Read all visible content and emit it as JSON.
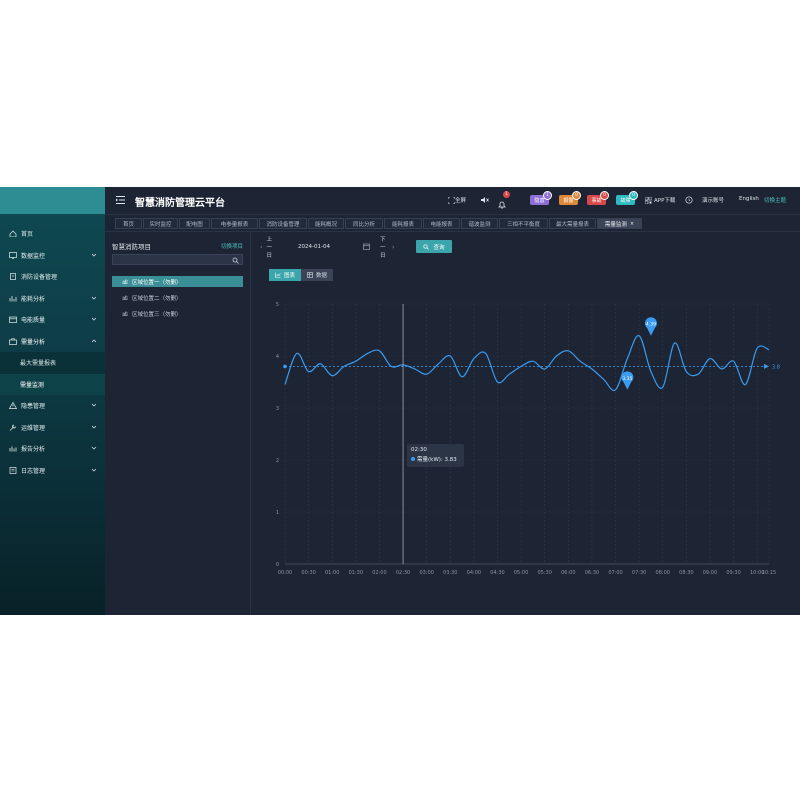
{
  "app": {
    "title": "智慧消防管理云平台"
  },
  "sidebar": {
    "items": [
      {
        "label": "首页",
        "icon": "home-icon",
        "has_arrow": false
      },
      {
        "label": "数据监控",
        "icon": "monitor-icon",
        "has_arrow": true
      },
      {
        "label": "消防设备管理",
        "icon": "device-icon",
        "has_arrow": false
      },
      {
        "label": "能耗分析",
        "icon": "bar-chart-icon",
        "has_arrow": true
      },
      {
        "label": "电能质量",
        "icon": "calendar-icon",
        "has_arrow": true
      },
      {
        "label": "需量分析",
        "icon": "briefcase-icon",
        "has_arrow": true,
        "open": true,
        "children": [
          {
            "label": "最大需量报表",
            "active": false
          },
          {
            "label": "需量监测",
            "active": true
          }
        ]
      },
      {
        "label": "隐患管理",
        "icon": "warning-icon",
        "has_arrow": true
      },
      {
        "label": "运维管理",
        "icon": "tools-icon",
        "has_arrow": true
      },
      {
        "label": "报告分析",
        "icon": "report-icon",
        "has_arrow": true
      },
      {
        "label": "日志管理",
        "icon": "log-icon",
        "has_arrow": true
      }
    ]
  },
  "header": {
    "fullscreen": "全屏",
    "bell_count": "1",
    "pills": [
      {
        "label": "隐患",
        "count": "1",
        "color": "#8e6fd6"
      },
      {
        "label": "报警",
        "count": "0",
        "color": "#e0883a"
      },
      {
        "label": "事故",
        "count": "0",
        "color": "#d84a4a"
      },
      {
        "label": "故障",
        "count": "0",
        "color": "#2fb9c0"
      }
    ],
    "app_download": "APP下载",
    "account": "演示账号",
    "language": "English",
    "theme": "切换主题",
    "colors": {
      "accent": "#3aa5ab",
      "link": "#4fc3c6"
    }
  },
  "tabs": [
    {
      "label": "首页",
      "active": false
    },
    {
      "label": "实时监控",
      "active": false
    },
    {
      "label": "配电图",
      "active": false
    },
    {
      "label": "电参量报表",
      "active": false
    },
    {
      "label": "消防设备管理",
      "active": false
    },
    {
      "label": "能耗概况",
      "active": false
    },
    {
      "label": "同比分析",
      "active": false
    },
    {
      "label": "能耗报表",
      "active": false
    },
    {
      "label": "电能报表",
      "active": false
    },
    {
      "label": "谐波监测",
      "active": false
    },
    {
      "label": "三相不平衡度",
      "active": false
    },
    {
      "label": "最大需量报表",
      "active": false
    },
    {
      "label": "需量监测",
      "active": true,
      "closable": true
    }
  ],
  "left_panel": {
    "title": "智慧消防项目",
    "switch": "切换项目",
    "search_value": "",
    "tree": [
      {
        "label": "区域位置一（勿删）",
        "selected": true
      },
      {
        "label": "区域位置二（勿删）",
        "selected": false
      },
      {
        "label": "区域位置三（勿删）",
        "selected": false
      }
    ]
  },
  "toolbar": {
    "prev": "上一日",
    "date": "2024-01-04",
    "next": "下一日",
    "query": "查询",
    "chart_mode": "图表",
    "data_mode": "数据"
  },
  "tooltip": {
    "time": "02:30",
    "label": "需量(kW): 3.83"
  },
  "chart_data": {
    "type": "line",
    "x": [
      "00:00",
      "00:15",
      "00:30",
      "00:45",
      "01:00",
      "01:15",
      "01:30",
      "01:45",
      "02:00",
      "02:15",
      "02:30",
      "02:45",
      "03:00",
      "03:15",
      "03:30",
      "03:45",
      "04:00",
      "04:15",
      "04:30",
      "04:45",
      "05:00",
      "05:15",
      "05:30",
      "05:45",
      "06:00",
      "06:15",
      "06:30",
      "06:45",
      "07:00",
      "07:15",
      "07:30",
      "07:45",
      "08:00",
      "08:15",
      "08:30",
      "08:45",
      "09:00",
      "09:15",
      "09:30",
      "09:45",
      "10:00",
      "10:15"
    ],
    "xticks": [
      "00:00",
      "00:30",
      "01:00",
      "01:30",
      "02:00",
      "02:30",
      "03:00",
      "03:30",
      "04:00",
      "04:30",
      "05:00",
      "05:30",
      "06:00",
      "06:30",
      "07:00",
      "07:30",
      "08:00",
      "08:30",
      "09:00",
      "09:30",
      "10:00",
      "10:15"
    ],
    "series": [
      {
        "values": [
          3.45,
          4.05,
          3.7,
          3.85,
          3.62,
          3.8,
          3.9,
          4.05,
          4.1,
          3.8,
          3.83,
          3.75,
          3.65,
          3.85,
          4.0,
          3.6,
          3.95,
          4.05,
          3.5,
          3.65,
          3.8,
          3.9,
          3.75,
          4.0,
          4.1,
          3.9,
          3.75,
          3.55,
          3.35,
          3.95,
          4.39,
          3.7,
          3.4,
          4.25,
          3.7,
          3.65,
          3.95,
          3.75,
          3.9,
          3.45,
          4.15,
          4.12
        ]
      }
    ],
    "markers": [
      {
        "x": "07:15",
        "value": 3.35,
        "label": "3.35"
      },
      {
        "x": "07:45",
        "value": 4.39,
        "label": "4.39"
      }
    ],
    "average": {
      "value": 3.8,
      "label": "3.8"
    },
    "ylim": [
      0,
      5
    ],
    "yticks": [
      0,
      1,
      2,
      3,
      4,
      5
    ],
    "grid": true,
    "line_color": "#3a9bf0"
  }
}
